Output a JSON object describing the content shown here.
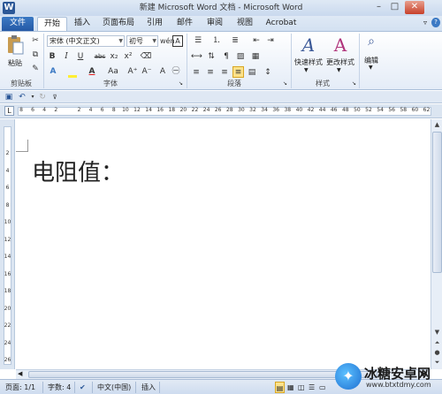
{
  "window": {
    "title": "新建 Microsoft Word 文档 - Microsoft Word"
  },
  "tabs": [
    "文件",
    "开始",
    "插入",
    "页面布局",
    "引用",
    "邮件",
    "审阅",
    "视图",
    "Acrobat"
  ],
  "ribbon": {
    "clipboard": {
      "paste_label": "粘贴",
      "group_label": "剪贴板"
    },
    "font": {
      "font_name": "宋体 (中文正文)",
      "font_size": "初号",
      "group_label": "字体",
      "bold": "B",
      "italic": "I",
      "underline": "U",
      "strike": "abc",
      "subscript": "x₂",
      "superscript": "x²",
      "grow": "A⁺",
      "shrink": "A⁻",
      "case": "Aa"
    },
    "paragraph": {
      "group_label": "段落"
    },
    "styles": {
      "quick_styles": "快速样式",
      "change_styles": "更改样式",
      "group_label": "样式"
    },
    "editing": {
      "label": "编辑"
    }
  },
  "ruler": {
    "numbers": [
      "8",
      "6",
      "4",
      "2",
      "",
      "2",
      "4",
      "6",
      "8",
      "10",
      "12",
      "14",
      "16",
      "18",
      "20",
      "22",
      "24",
      "26",
      "28",
      "30",
      "32",
      "34",
      "36",
      "38",
      "40",
      "42",
      "44",
      "46",
      "48",
      "50",
      "52",
      "54",
      "56",
      "58",
      "60",
      "62"
    ]
  },
  "vruler": {
    "numbers": [
      "2",
      "4",
      "6",
      "8",
      "10",
      "12",
      "14",
      "16",
      "18",
      "20",
      "22",
      "24",
      "26"
    ]
  },
  "document": {
    "text": "电阻值："
  },
  "status": {
    "page": "页面: 1/1",
    "words": "字数: 4",
    "language": "中文(中国)",
    "mode": "插入"
  },
  "watermark": {
    "brand": "冰糖安卓网",
    "url": "www.btxtdmy.com",
    "logo_glyph": "✦"
  },
  "colors": {
    "file_tab": "#2b5797",
    "ribbon_border": "#aabfd9",
    "highlight_yellow": "#ffee33",
    "font_red": "#e02020"
  }
}
